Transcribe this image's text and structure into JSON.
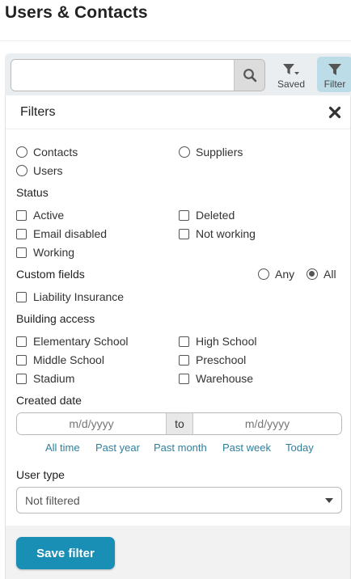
{
  "page": {
    "title": "Users & Contacts"
  },
  "search": {
    "value": "",
    "placeholder": "",
    "icon": "search-icon"
  },
  "toolbar": {
    "saved_label": "Saved",
    "filter_label": "Filter",
    "filter_active_color": "#bcdde8"
  },
  "filters": {
    "title": "Filters",
    "close_icon": "close-icon",
    "record_types": [
      {
        "label": "Contacts",
        "checked": false
      },
      {
        "label": "Suppliers",
        "checked": false
      },
      {
        "label": "Users",
        "checked": false
      }
    ],
    "status": {
      "heading": "Status",
      "options": [
        {
          "label": "Active",
          "checked": false
        },
        {
          "label": "Deleted",
          "checked": false
        },
        {
          "label": "Email disabled",
          "checked": false
        },
        {
          "label": "Not working",
          "checked": false
        },
        {
          "label": "Working",
          "checked": false
        }
      ]
    },
    "custom_fields": {
      "heading": "Custom fields",
      "any_label": "Any",
      "all_label": "All",
      "selected": "All",
      "options": [
        {
          "label": "Liability Insurance",
          "checked": false
        }
      ]
    },
    "building_access": {
      "heading": "Building access",
      "options": [
        {
          "label": "Elementary School",
          "checked": false
        },
        {
          "label": "High School",
          "checked": false
        },
        {
          "label": "Middle School",
          "checked": false
        },
        {
          "label": "Preschool",
          "checked": false
        },
        {
          "label": "Stadium",
          "checked": false
        },
        {
          "label": "Warehouse",
          "checked": false
        }
      ]
    },
    "created_date": {
      "heading": "Created date",
      "from_placeholder": "m/d/yyyy",
      "separator": "to",
      "to_placeholder": "m/d/yyyy",
      "quick_ranges": [
        "All time",
        "Past year",
        "Past month",
        "Past week",
        "Today"
      ]
    },
    "user_type": {
      "heading": "User type",
      "selected": "Not filtered"
    },
    "save_label": "Save filter"
  },
  "colors": {
    "accent": "#1a8fb5",
    "link": "#2e7f9c",
    "toolbar_bg": "#eaeef1",
    "footer_bg": "#f2f2f2"
  }
}
